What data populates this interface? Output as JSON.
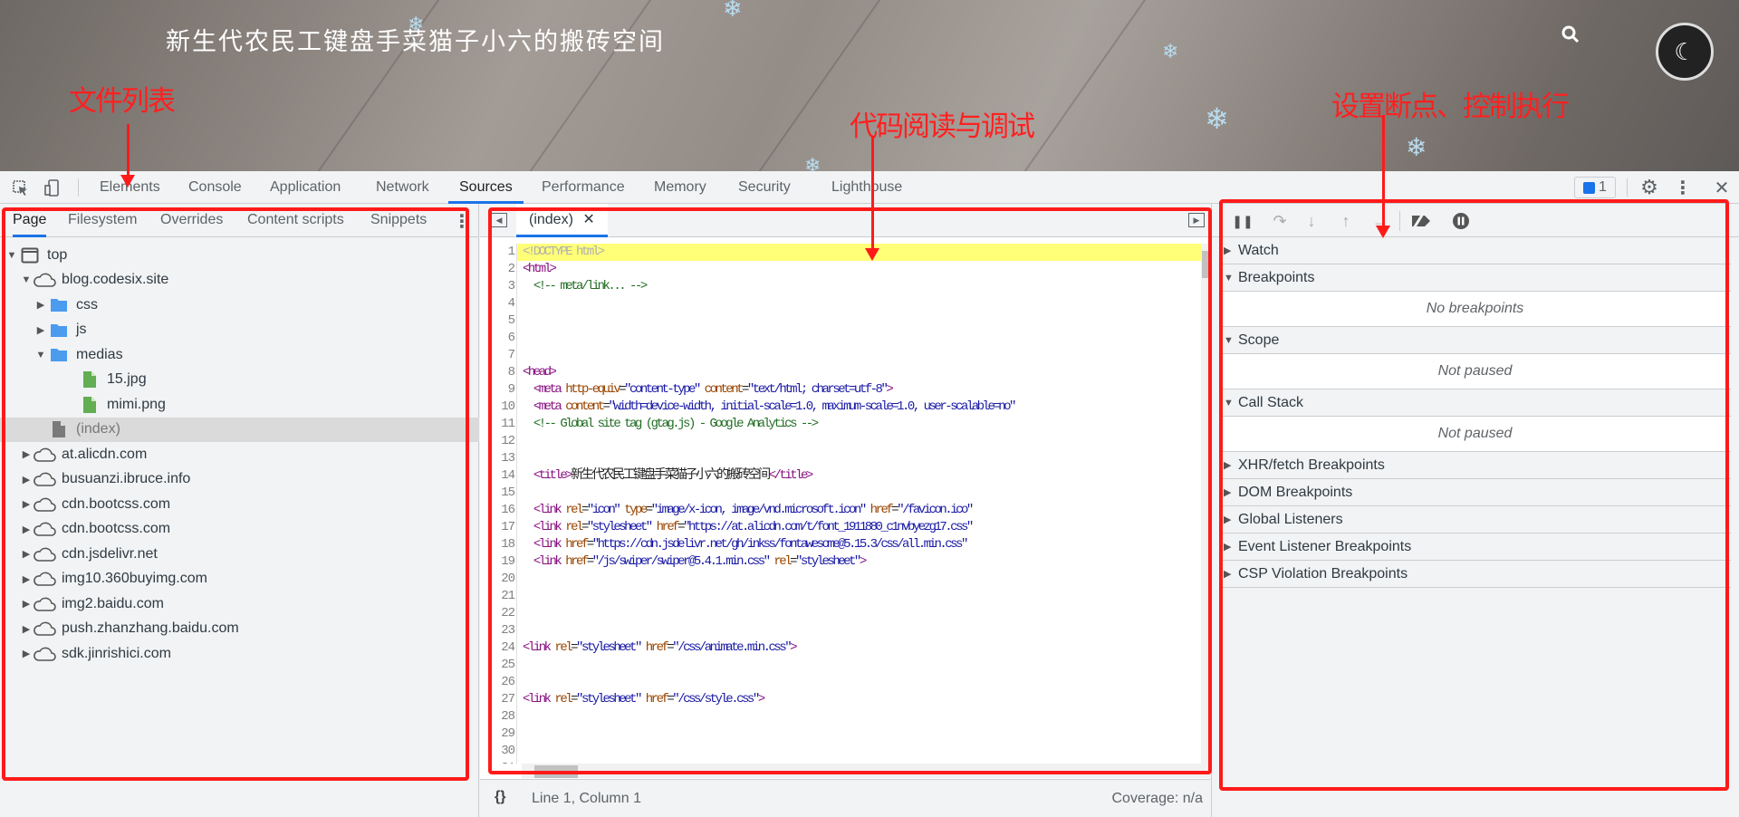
{
  "banner": {
    "title": "新生代农民工键盘手菜猫子小六的搬砖空间",
    "search_icon": "search-icon",
    "theme_icon": "moon-icon"
  },
  "toolbar": {
    "tabs": [
      {
        "label": "Elements"
      },
      {
        "label": "Console"
      },
      {
        "label": "Application"
      },
      {
        "label": "Network"
      },
      {
        "label": "Sources",
        "active": true
      },
      {
        "label": "Performance"
      },
      {
        "label": "Memory"
      },
      {
        "label": "Security"
      },
      {
        "label": "Lighthouse"
      }
    ],
    "issues_count": "1"
  },
  "navigator": {
    "tabs": [
      {
        "label": "Page",
        "active": true
      },
      {
        "label": "Filesystem"
      },
      {
        "label": "Overrides"
      },
      {
        "label": "Content scripts"
      },
      {
        "label": "Snippets"
      }
    ],
    "tree": [
      {
        "label": "top",
        "level": 0,
        "expander": "open",
        "icon": "frame"
      },
      {
        "label": "blog.codesix.site",
        "level": 1,
        "expander": "open",
        "icon": "cloud"
      },
      {
        "label": "css",
        "level": 2,
        "expander": "closed",
        "icon": "folder"
      },
      {
        "label": "js",
        "level": 2,
        "expander": "closed",
        "icon": "folder"
      },
      {
        "label": "medias",
        "level": 2,
        "expander": "open",
        "icon": "folder"
      },
      {
        "label": "15.jpg",
        "level": 3,
        "expander": "none",
        "icon": "image-file"
      },
      {
        "label": "mimi.png",
        "level": 3,
        "expander": "none",
        "icon": "image-file"
      },
      {
        "label": "(index)",
        "level": 2,
        "expander": "none",
        "icon": "document-file",
        "selected": true
      },
      {
        "label": "at.alicdn.com",
        "level": 1,
        "expander": "closed",
        "icon": "cloud"
      },
      {
        "label": "busuanzi.ibruce.info",
        "level": 1,
        "expander": "closed",
        "icon": "cloud"
      },
      {
        "label": "cdn.bootcss.com",
        "level": 1,
        "expander": "closed",
        "icon": "cloud"
      },
      {
        "label": "cdn.bootcss.com",
        "level": 1,
        "expander": "closed",
        "icon": "cloud"
      },
      {
        "label": "cdn.jsdelivr.net",
        "level": 1,
        "expander": "closed",
        "icon": "cloud"
      },
      {
        "label": "img10.360buyimg.com",
        "level": 1,
        "expander": "closed",
        "icon": "cloud"
      },
      {
        "label": "img2.baidu.com",
        "level": 1,
        "expander": "closed",
        "icon": "cloud"
      },
      {
        "label": "push.zhanzhang.baidu.com",
        "level": 1,
        "expander": "closed",
        "icon": "cloud"
      },
      {
        "label": "sdk.jinrishici.com",
        "level": 1,
        "expander": "closed",
        "icon": "cloud"
      }
    ]
  },
  "editor": {
    "tab_label": "(index)",
    "lines": [
      [
        [
          "doc",
          "<!DOCTYPE html>"
        ]
      ],
      [
        [
          "tag",
          "<html>"
        ]
      ],
      [
        [
          "plain",
          "  "
        ],
        [
          "cmt",
          "<!-- meta/link... -->"
        ]
      ],
      [],
      [],
      [],
      [],
      [
        [
          "tag",
          "<head>"
        ]
      ],
      [
        [
          "plain",
          "  "
        ],
        [
          "tag",
          "<meta "
        ],
        [
          "attr",
          "http-equiv"
        ],
        [
          "plain",
          "="
        ],
        [
          "val",
          "\"content-type\""
        ],
        [
          "attr",
          " content"
        ],
        [
          "plain",
          "="
        ],
        [
          "val",
          "\"text/html; charset=utf-8\""
        ],
        [
          "tag",
          ">"
        ]
      ],
      [
        [
          "plain",
          "  "
        ],
        [
          "tag",
          "<meta "
        ],
        [
          "attr",
          "content"
        ],
        [
          "plain",
          "="
        ],
        [
          "val",
          "\"width=device-width, initial-scale=1.0, maximum-scale=1.0, user-scalable=no\""
        ]
      ],
      [
        [
          "plain",
          "  "
        ],
        [
          "cmt",
          "<!-- Global site tag (gtag.js) - Google Analytics -->"
        ]
      ],
      [],
      [],
      [
        [
          "plain",
          "  "
        ],
        [
          "tag",
          "<title>"
        ],
        [
          "plain",
          "新生代农民工键盘手菜猫子小六的搬砖空间"
        ],
        [
          "tag",
          "</title>"
        ]
      ],
      [],
      [
        [
          "plain",
          "  "
        ],
        [
          "tag",
          "<link "
        ],
        [
          "attr",
          "rel"
        ],
        [
          "plain",
          "="
        ],
        [
          "val",
          "\"icon\""
        ],
        [
          "attr",
          " type"
        ],
        [
          "plain",
          "="
        ],
        [
          "val",
          "\"image/x-icon, image/vnd.microsoft.icon\""
        ],
        [
          "attr",
          " href"
        ],
        [
          "plain",
          "="
        ],
        [
          "val",
          "\"/favicon.ico\""
        ]
      ],
      [
        [
          "plain",
          "  "
        ],
        [
          "tag",
          "<link "
        ],
        [
          "attr",
          "rel"
        ],
        [
          "plain",
          "="
        ],
        [
          "val",
          "\"stylesheet\""
        ],
        [
          "attr",
          " href"
        ],
        [
          "plain",
          "="
        ],
        [
          "val",
          "\"https://at.alicdn.com/t/font_1911880_c1nvbyezg17.css\""
        ]
      ],
      [
        [
          "plain",
          "  "
        ],
        [
          "tag",
          "<link "
        ],
        [
          "attr",
          "href"
        ],
        [
          "plain",
          "="
        ],
        [
          "val",
          "\"https://cdn.jsdelivr.net/gh/inkss/fontawesome@5.15.3/css/all.min.css\""
        ]
      ],
      [
        [
          "plain",
          "  "
        ],
        [
          "tag",
          "<link "
        ],
        [
          "attr",
          "href"
        ],
        [
          "plain",
          "="
        ],
        [
          "val",
          "\"/js/swiper/swiper@5.4.1.min.css\""
        ],
        [
          "attr",
          " rel"
        ],
        [
          "plain",
          "="
        ],
        [
          "val",
          "\"stylesheet\""
        ],
        [
          "tag",
          ">"
        ]
      ],
      [],
      [],
      [],
      [],
      [
        [
          "tag",
          "<link "
        ],
        [
          "attr",
          "rel"
        ],
        [
          "plain",
          "="
        ],
        [
          "val",
          "\"stylesheet\""
        ],
        [
          "attr",
          " href"
        ],
        [
          "plain",
          "="
        ],
        [
          "val",
          "\"/css/animate.min.css\""
        ],
        [
          "tag",
          ">"
        ]
      ],
      [],
      [],
      [
        [
          "tag",
          "<link "
        ],
        [
          "attr",
          "rel"
        ],
        [
          "plain",
          "="
        ],
        [
          "val",
          "\"stylesheet\""
        ],
        [
          "attr",
          " href"
        ],
        [
          "plain",
          "="
        ],
        [
          "val",
          "\"/css/style.css\""
        ],
        [
          "tag",
          ">"
        ]
      ],
      [],
      [],
      [],
      [],
      []
    ],
    "status": {
      "position": "Line 1, Column 1",
      "coverage": "Coverage: n/a"
    }
  },
  "debugger": {
    "sections": [
      {
        "label": "Watch",
        "open": false
      },
      {
        "label": "Breakpoints",
        "open": true,
        "body": "No breakpoints"
      },
      {
        "label": "Scope",
        "open": true,
        "body": "Not paused"
      },
      {
        "label": "Call Stack",
        "open": true,
        "body": "Not paused"
      },
      {
        "label": "XHR/fetch Breakpoints",
        "open": false
      },
      {
        "label": "DOM Breakpoints",
        "open": false
      },
      {
        "label": "Global Listeners",
        "open": false
      },
      {
        "label": "Event Listener Breakpoints",
        "open": false
      },
      {
        "label": "CSP Violation Breakpoints",
        "open": false
      }
    ]
  },
  "annotations": {
    "file_list": "文件列表",
    "code_reading": "代码阅读与调试",
    "breakpoints": "设置断点、控制执行",
    "color": "#ff1a1a"
  }
}
